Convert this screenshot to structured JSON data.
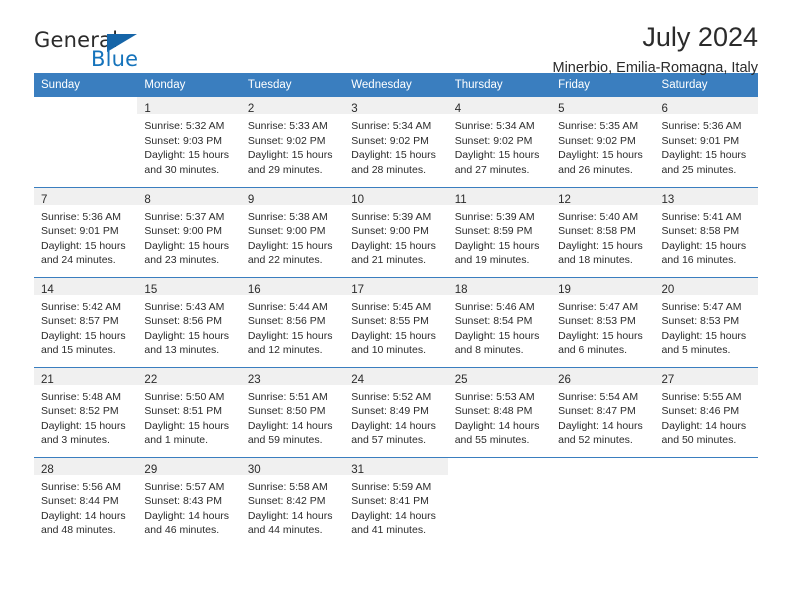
{
  "brand": {
    "word_one": "General",
    "word_two": "Blue",
    "flag_icon": "triangle-flag-icon",
    "accent_color": "#1573bb"
  },
  "header": {
    "title": "July 2024",
    "subtitle": "Minerbio, Emilia-Romagna, Italy"
  },
  "calendar": {
    "header_color": "#3a7ebf",
    "daynum_band_color": "#f0f0f0",
    "weekdays": [
      "Sunday",
      "Monday",
      "Tuesday",
      "Wednesday",
      "Thursday",
      "Friday",
      "Saturday"
    ],
    "weeks": [
      [
        {
          "day": "",
          "lines": []
        },
        {
          "day": "1",
          "lines": [
            "Sunrise: 5:32 AM",
            "Sunset: 9:03 PM",
            "Daylight: 15 hours",
            "and 30 minutes."
          ]
        },
        {
          "day": "2",
          "lines": [
            "Sunrise: 5:33 AM",
            "Sunset: 9:02 PM",
            "Daylight: 15 hours",
            "and 29 minutes."
          ]
        },
        {
          "day": "3",
          "lines": [
            "Sunrise: 5:34 AM",
            "Sunset: 9:02 PM",
            "Daylight: 15 hours",
            "and 28 minutes."
          ]
        },
        {
          "day": "4",
          "lines": [
            "Sunrise: 5:34 AM",
            "Sunset: 9:02 PM",
            "Daylight: 15 hours",
            "and 27 minutes."
          ]
        },
        {
          "day": "5",
          "lines": [
            "Sunrise: 5:35 AM",
            "Sunset: 9:02 PM",
            "Daylight: 15 hours",
            "and 26 minutes."
          ]
        },
        {
          "day": "6",
          "lines": [
            "Sunrise: 5:36 AM",
            "Sunset: 9:01 PM",
            "Daylight: 15 hours",
            "and 25 minutes."
          ]
        }
      ],
      [
        {
          "day": "7",
          "lines": [
            "Sunrise: 5:36 AM",
            "Sunset: 9:01 PM",
            "Daylight: 15 hours",
            "and 24 minutes."
          ]
        },
        {
          "day": "8",
          "lines": [
            "Sunrise: 5:37 AM",
            "Sunset: 9:00 PM",
            "Daylight: 15 hours",
            "and 23 minutes."
          ]
        },
        {
          "day": "9",
          "lines": [
            "Sunrise: 5:38 AM",
            "Sunset: 9:00 PM",
            "Daylight: 15 hours",
            "and 22 minutes."
          ]
        },
        {
          "day": "10",
          "lines": [
            "Sunrise: 5:39 AM",
            "Sunset: 9:00 PM",
            "Daylight: 15 hours",
            "and 21 minutes."
          ]
        },
        {
          "day": "11",
          "lines": [
            "Sunrise: 5:39 AM",
            "Sunset: 8:59 PM",
            "Daylight: 15 hours",
            "and 19 minutes."
          ]
        },
        {
          "day": "12",
          "lines": [
            "Sunrise: 5:40 AM",
            "Sunset: 8:58 PM",
            "Daylight: 15 hours",
            "and 18 minutes."
          ]
        },
        {
          "day": "13",
          "lines": [
            "Sunrise: 5:41 AM",
            "Sunset: 8:58 PM",
            "Daylight: 15 hours",
            "and 16 minutes."
          ]
        }
      ],
      [
        {
          "day": "14",
          "lines": [
            "Sunrise: 5:42 AM",
            "Sunset: 8:57 PM",
            "Daylight: 15 hours",
            "and 15 minutes."
          ]
        },
        {
          "day": "15",
          "lines": [
            "Sunrise: 5:43 AM",
            "Sunset: 8:56 PM",
            "Daylight: 15 hours",
            "and 13 minutes."
          ]
        },
        {
          "day": "16",
          "lines": [
            "Sunrise: 5:44 AM",
            "Sunset: 8:56 PM",
            "Daylight: 15 hours",
            "and 12 minutes."
          ]
        },
        {
          "day": "17",
          "lines": [
            "Sunrise: 5:45 AM",
            "Sunset: 8:55 PM",
            "Daylight: 15 hours",
            "and 10 minutes."
          ]
        },
        {
          "day": "18",
          "lines": [
            "Sunrise: 5:46 AM",
            "Sunset: 8:54 PM",
            "Daylight: 15 hours",
            "and 8 minutes."
          ]
        },
        {
          "day": "19",
          "lines": [
            "Sunrise: 5:47 AM",
            "Sunset: 8:53 PM",
            "Daylight: 15 hours",
            "and 6 minutes."
          ]
        },
        {
          "day": "20",
          "lines": [
            "Sunrise: 5:47 AM",
            "Sunset: 8:53 PM",
            "Daylight: 15 hours",
            "and 5 minutes."
          ]
        }
      ],
      [
        {
          "day": "21",
          "lines": [
            "Sunrise: 5:48 AM",
            "Sunset: 8:52 PM",
            "Daylight: 15 hours",
            "and 3 minutes."
          ]
        },
        {
          "day": "22",
          "lines": [
            "Sunrise: 5:50 AM",
            "Sunset: 8:51 PM",
            "Daylight: 15 hours",
            "and 1 minute."
          ]
        },
        {
          "day": "23",
          "lines": [
            "Sunrise: 5:51 AM",
            "Sunset: 8:50 PM",
            "Daylight: 14 hours",
            "and 59 minutes."
          ]
        },
        {
          "day": "24",
          "lines": [
            "Sunrise: 5:52 AM",
            "Sunset: 8:49 PM",
            "Daylight: 14 hours",
            "and 57 minutes."
          ]
        },
        {
          "day": "25",
          "lines": [
            "Sunrise: 5:53 AM",
            "Sunset: 8:48 PM",
            "Daylight: 14 hours",
            "and 55 minutes."
          ]
        },
        {
          "day": "26",
          "lines": [
            "Sunrise: 5:54 AM",
            "Sunset: 8:47 PM",
            "Daylight: 14 hours",
            "and 52 minutes."
          ]
        },
        {
          "day": "27",
          "lines": [
            "Sunrise: 5:55 AM",
            "Sunset: 8:46 PM",
            "Daylight: 14 hours",
            "and 50 minutes."
          ]
        }
      ],
      [
        {
          "day": "28",
          "lines": [
            "Sunrise: 5:56 AM",
            "Sunset: 8:44 PM",
            "Daylight: 14 hours",
            "and 48 minutes."
          ]
        },
        {
          "day": "29",
          "lines": [
            "Sunrise: 5:57 AM",
            "Sunset: 8:43 PM",
            "Daylight: 14 hours",
            "and 46 minutes."
          ]
        },
        {
          "day": "30",
          "lines": [
            "Sunrise: 5:58 AM",
            "Sunset: 8:42 PM",
            "Daylight: 14 hours",
            "and 44 minutes."
          ]
        },
        {
          "day": "31",
          "lines": [
            "Sunrise: 5:59 AM",
            "Sunset: 8:41 PM",
            "Daylight: 14 hours",
            "and 41 minutes."
          ]
        },
        {
          "day": "",
          "lines": []
        },
        {
          "day": "",
          "lines": []
        },
        {
          "day": "",
          "lines": []
        }
      ]
    ]
  }
}
